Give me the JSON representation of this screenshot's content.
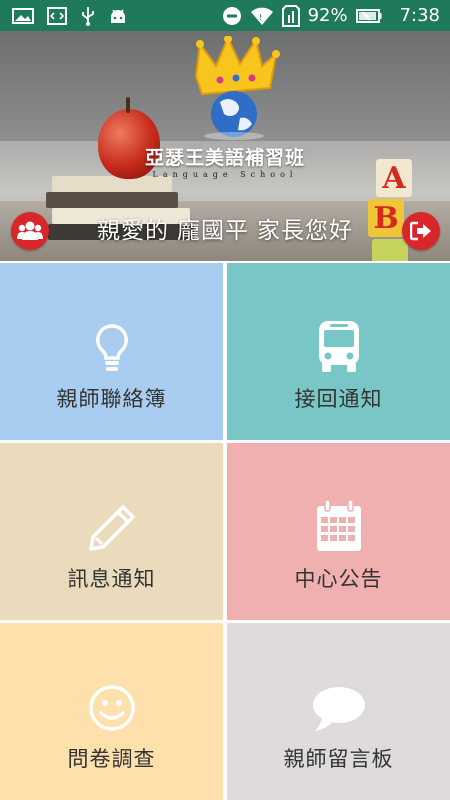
{
  "status_bar": {
    "battery_percent": "92%",
    "time": "7:38",
    "icons": [
      "image-icon",
      "code-icon",
      "usb-icon",
      "android-icon",
      "do-not-disturb-icon",
      "wifi-icon",
      "sim-icon",
      "battery-icon"
    ]
  },
  "header": {
    "school_name": "亞瑟王美語補習班",
    "school_subtitle": "Language School",
    "greeting": {
      "prefix": "親愛的",
      "name": "龐國平",
      "suffix": "家長您好"
    },
    "block_letters": [
      "A",
      "B"
    ]
  },
  "menu": [
    {
      "label": "親師聯絡簿",
      "icon": "lightbulb-icon",
      "color": "#a8cdf0"
    },
    {
      "label": "接回通知",
      "icon": "bus-icon",
      "color": "#79c6c6"
    },
    {
      "label": "訊息通知",
      "icon": "pencil-icon",
      "color": "#e9dbbb"
    },
    {
      "label": "中心公告",
      "icon": "calendar-icon",
      "color": "#f0b0b0"
    },
    {
      "label": "問卷調查",
      "icon": "smiley-icon",
      "color": "#fde0ac"
    },
    {
      "label": "親師留言板",
      "icon": "speech-bubble-icon",
      "color": "#dedadd"
    }
  ],
  "colors": {
    "status_bar": "#1f7a59",
    "accent_red": "#d8262a"
  }
}
